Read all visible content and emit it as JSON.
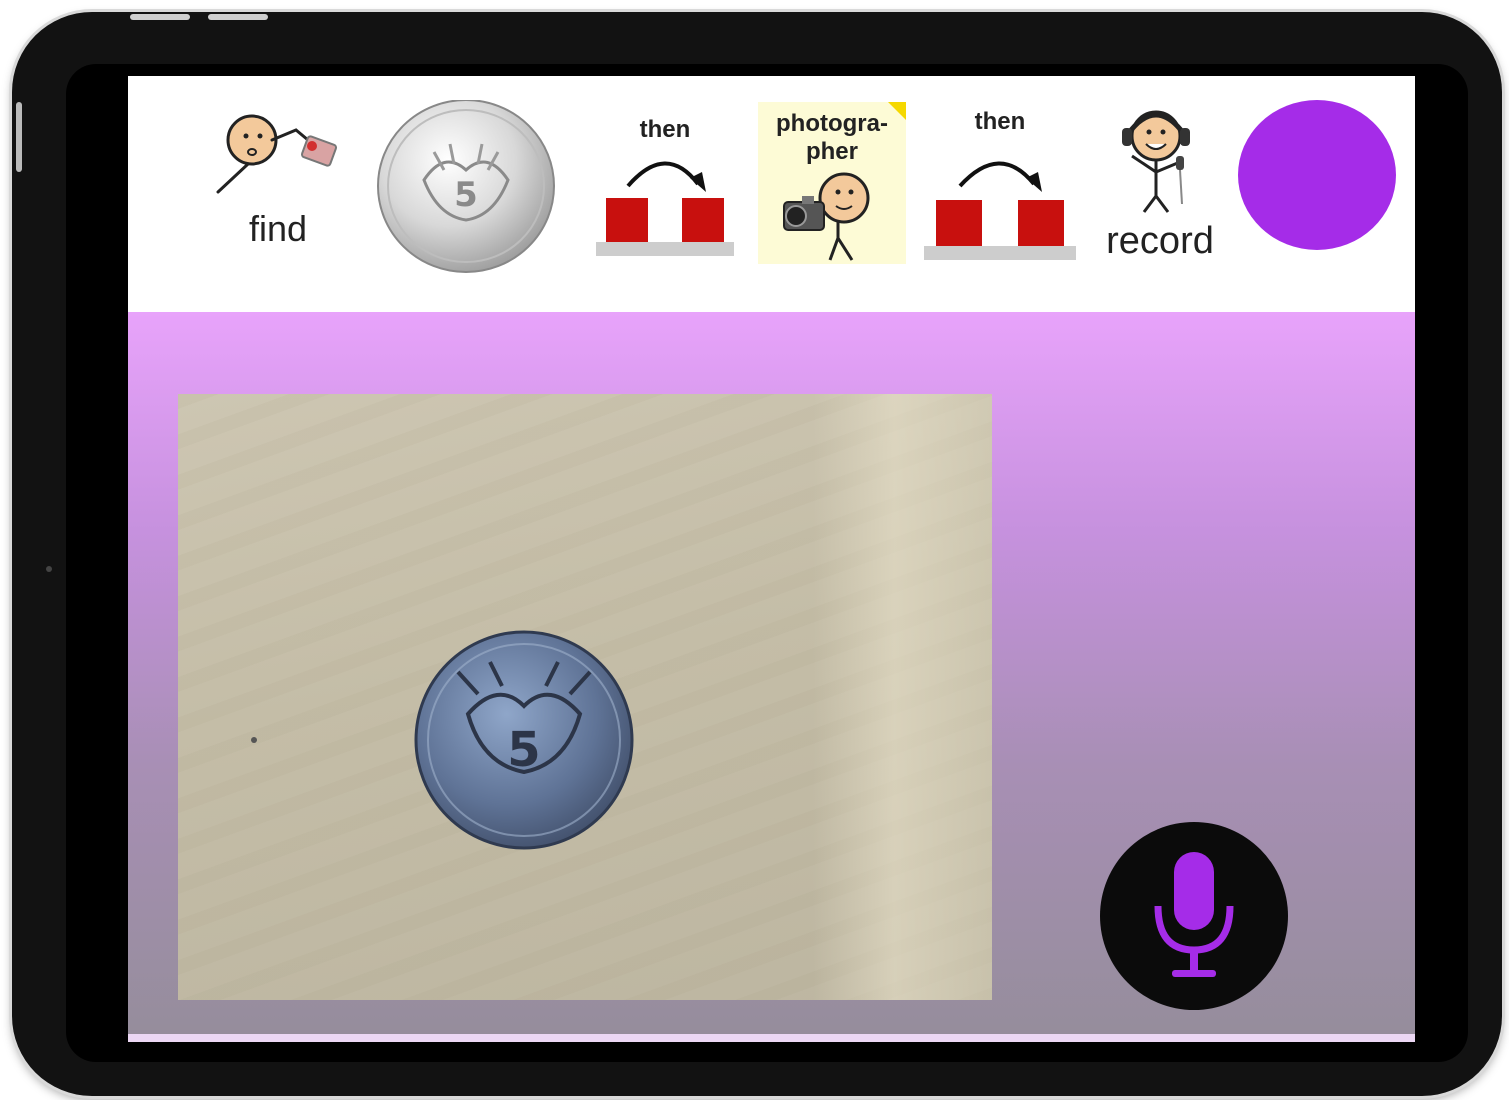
{
  "schedule": {
    "items": [
      {
        "label": "find",
        "icon": "find-person-icon"
      },
      {
        "label": "",
        "icon": "coin-icon"
      },
      {
        "label": "then",
        "icon": "then-arrow-icon"
      },
      {
        "label": "photogra-\npher",
        "icon": "photographer-icon"
      },
      {
        "label": "then",
        "icon": "then-arrow-icon"
      },
      {
        "label": "record",
        "icon": "record-person-icon"
      }
    ],
    "status_color": "#a52ce8"
  },
  "main": {
    "camera_subject_icon": "coin-icon",
    "mic_icon": "microphone-icon",
    "mic_color": "#a52ce8",
    "background_colors": [
      "#e8a3fb",
      "#958d9b"
    ]
  }
}
